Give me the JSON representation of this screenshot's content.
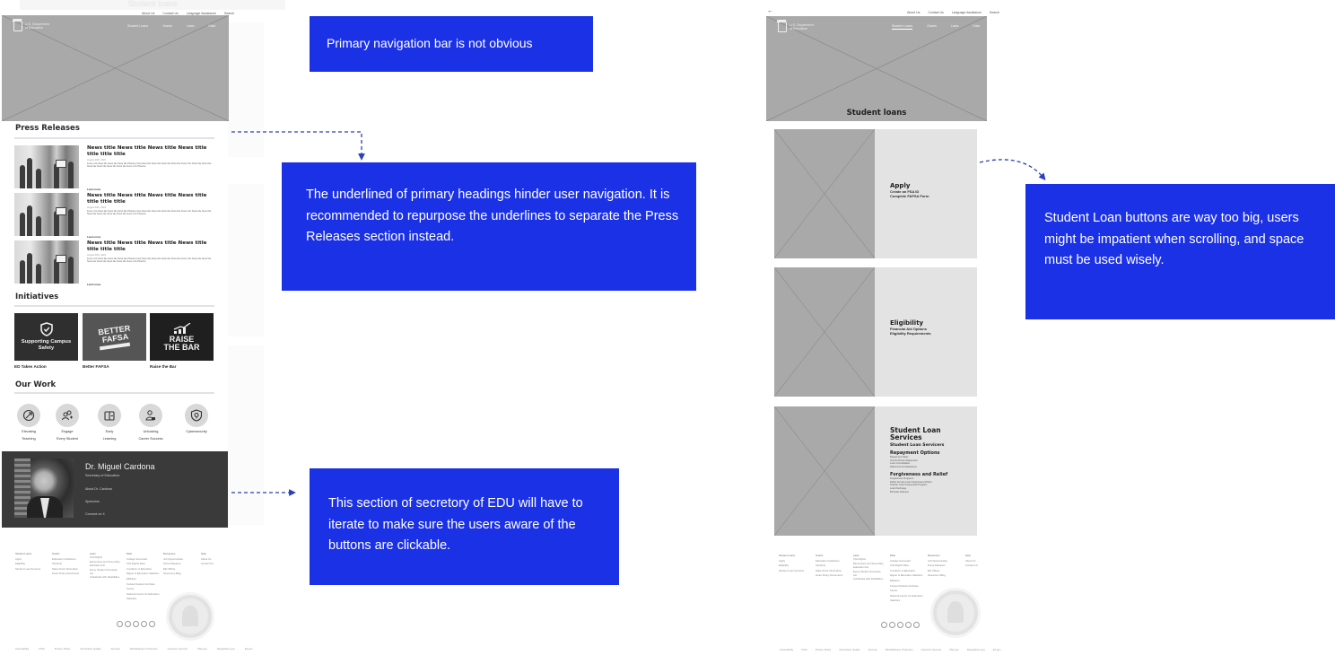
{
  "ghost": {
    "top_title": "Student loans"
  },
  "left_wireframe": {
    "utility_nav": [
      "About Us",
      "Contact Us",
      "Language Assistance",
      "Search"
    ],
    "logo_text": "U.S. Department of Education",
    "main_nav": [
      "Student Loans",
      "Grants",
      "Laws",
      "Data"
    ],
    "press_releases": {
      "heading": "Press Releases",
      "items": [
        {
          "title": "News title News title News title News title title title title",
          "date": "August 20th, 2024",
          "excerpt": "Fusce Cris News title News title News title Pharetra Cras News title News title News title News title Fusce Cris News title News title News title News title News title News title Fusce Cris Pharetra",
          "link": "Learn more"
        },
        {
          "title": "News title News title News title News title title title title",
          "date": "August 20th, 2024",
          "excerpt": "Fusce Cris News title News title News title Pharetra Cras News title News title News title News title Fusce Cris News title News title News title News title News title News title Fusce Cris Pharetra",
          "link": "Learn more"
        },
        {
          "title": "News title News title News title News title title title title",
          "date": "August 20th, 2024",
          "excerpt": "Fusce Cris News title News title News title Pharetra Cras News title News title News title News title Fusce Cris News title News title News title News title News title News title Fusce Cris Pharetra",
          "link": "Learn more"
        }
      ]
    },
    "initiatives": {
      "heading": "Initiatives",
      "cards": [
        {
          "image_text": "Supporting Campus Safety",
          "label": "ED Takes Action",
          "bg": "#2f2f2f",
          "icon": "shield-check-icon"
        },
        {
          "image_text": "BETTER FAFSA",
          "label": "Better FAFSA",
          "bg": "#555555",
          "icon": "fafsa-banner-icon"
        },
        {
          "image_text": "RAISE THE BAR",
          "label": "Raise the Bar",
          "bg": "#1f1f1f",
          "icon": "rising-chart-icon"
        }
      ]
    },
    "our_work": {
      "heading": "Our Work",
      "items": [
        {
          "label_1": "Elevating",
          "label_2": "Teaching",
          "icon": "rocket-icon"
        },
        {
          "label_1": "Engage",
          "label_2": "Every Student",
          "icon": "people-add-icon"
        },
        {
          "label_1": "Early",
          "label_2": "Learning",
          "icon": "book-icon"
        },
        {
          "label_1": "Unlocking",
          "label_2": "Career Success",
          "icon": "worker-icon"
        },
        {
          "label_1": "Cybersecurity",
          "label_2": "",
          "icon": "shield-lock-icon"
        }
      ]
    },
    "secretary": {
      "name": "Dr. Miguel Cardona",
      "role": "Secretary of Education",
      "links": [
        "About Dr. Cardona",
        "Speeches",
        "Connect on X"
      ]
    },
    "footer": {
      "columns": [
        [
          "Student Loans",
          "Apply",
          "Eligibility",
          "Student Loan Services"
        ],
        [
          "Grants",
          "Education Institutions",
          "Students",
          "State Grant Information",
          "Grant Policy Documents"
        ],
        [
          "Laws",
          "Civil Rights",
          "Elementary and Secondary Education Act",
          "Every Student Succeeds Act",
          "Individuals with Disabilities"
        ],
        [
          "Data",
          "College Scorecard",
          "Civil Rights Data",
          "Condition of Education",
          "Digest of Education Statistics",
          "EDFacts",
          "Federal Student Aid Data Center",
          "National Center for Education Statistics"
        ],
        [
          "Resources",
          "Job Opportunities",
          "Press Releases",
          "ED Offices",
          "Newsroom Blog"
        ],
        [
          "Help",
          "About Us",
          "Contact Us"
        ]
      ],
      "legal": [
        "Accessibility",
        "FOIA",
        "Privacy Policy",
        "Information Quality",
        "Security",
        "Whistleblower Protection",
        "Inspector General",
        "USA.gov",
        "Regulations.gov",
        "Ed.gov"
      ]
    }
  },
  "right_wireframe": {
    "back_icon": "back-arrow-icon",
    "utility_nav": [
      "About Us",
      "Contact Us",
      "Language Assistance",
      "Search"
    ],
    "logo_text": "U.S. Department of Education",
    "main_nav": [
      "Student Loans",
      "Grants",
      "Laws",
      "Data"
    ],
    "active_nav": "Student Loans",
    "hero_title": "Student loans",
    "cards": [
      {
        "title": "Apply",
        "links": [
          "Create an FSA ID",
          "Complete FAFSA Form"
        ]
      },
      {
        "title": "Eligibility",
        "links": [
          "Financial Aid Options",
          "Eligibility Requirements"
        ]
      },
      {
        "title": "Student Loan Services",
        "links": [
          "Student Loan Servicers"
        ],
        "sections": [
          {
            "heading": "Repayment Options",
            "items": [
              "Repayment Plans",
              "Income-Driven Repayment",
              "Loan Consolidation",
              "Deferment & Forbearance"
            ]
          },
          {
            "heading": "Forgiveness and Relief",
            "items": [
              "Forgiveness Programs",
              "Public Service Loan Forgiveness (PSLF)",
              "Teacher Loan Forgiveness Program",
              "Loan Discharge",
              "Borrower Defense"
            ]
          }
        ]
      }
    ]
  },
  "annotations": {
    "color": "#1b31e6",
    "nav_bar": "Primary navigation bar is not obvious",
    "headings": "The underlined of primary headings hinder user navigation. It is recommended to repurpose the underlines to separate the Press Releases section instead.",
    "secretary": "This section of secretory of EDU will have to iterate to make sure the users aware of the buttons are clickable.",
    "loan_buttons": "Student Loan buttons are way too big, users might be impatient when scrolling, and space must be used wisely."
  }
}
